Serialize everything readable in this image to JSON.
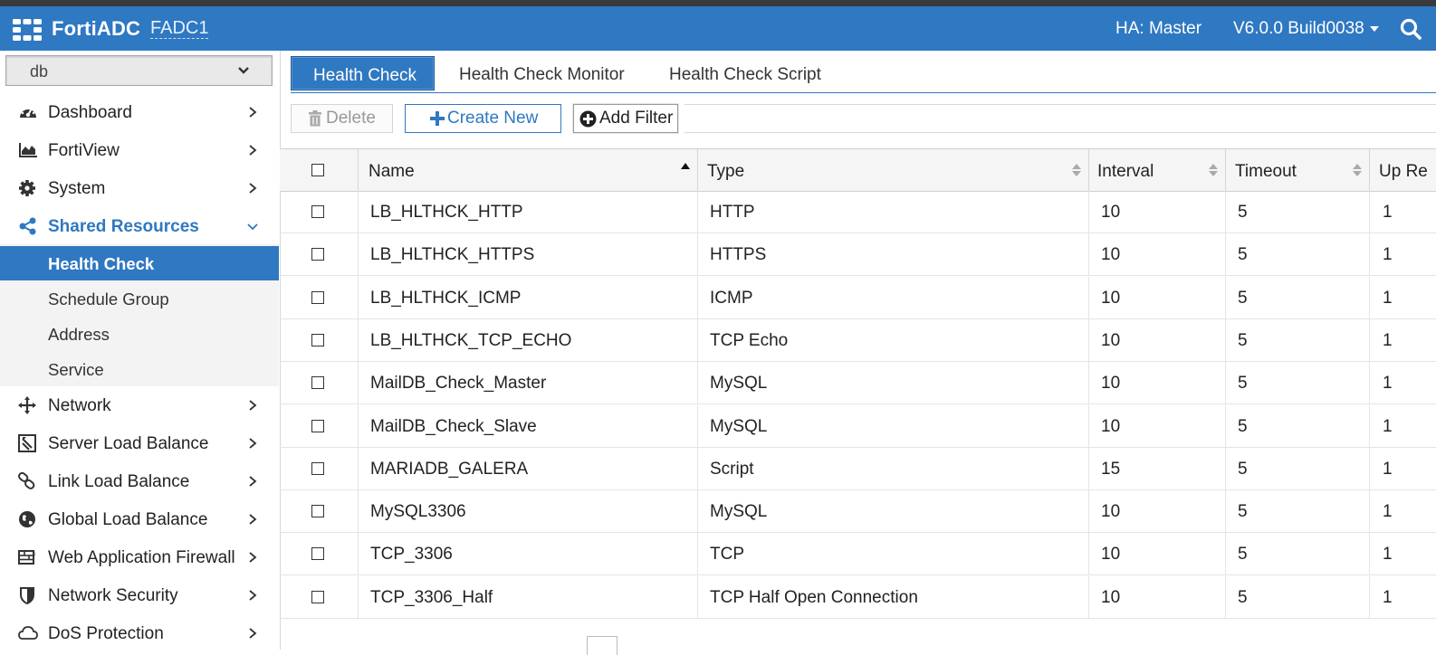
{
  "header": {
    "brand": "FortiADC",
    "device": "FADC1",
    "ha_status": "HA: Master",
    "version": "V6.0.0 Build0038"
  },
  "sidebar": {
    "vdom_selected": "db",
    "items": [
      {
        "label": "Dashboard",
        "icon": "dashboard-icon"
      },
      {
        "label": "FortiView",
        "icon": "chart-icon"
      },
      {
        "label": "System",
        "icon": "gear-icon"
      },
      {
        "label": "Shared Resources",
        "icon": "share-icon",
        "open": true
      },
      {
        "label": "Network",
        "icon": "network-icon"
      },
      {
        "label": "Server Load Balance",
        "icon": "server-load-balance-icon"
      },
      {
        "label": "Link Load Balance",
        "icon": "link-icon"
      },
      {
        "label": "Global Load Balance",
        "icon": "globe-icon"
      },
      {
        "label": "Web Application Firewall",
        "icon": "firewall-icon"
      },
      {
        "label": "Network Security",
        "icon": "shield-icon"
      },
      {
        "label": "DoS Protection",
        "icon": "cloud-icon"
      }
    ],
    "subitems": [
      {
        "label": "Health Check",
        "active": true
      },
      {
        "label": "Schedule Group"
      },
      {
        "label": "Address"
      },
      {
        "label": "Service"
      }
    ]
  },
  "tabs": [
    {
      "label": "Health Check",
      "active": true
    },
    {
      "label": "Health Check Monitor"
    },
    {
      "label": "Health Check Script"
    }
  ],
  "toolbar": {
    "delete_label": "Delete",
    "create_label": "Create New",
    "filter_label": "Add Filter"
  },
  "table": {
    "columns": [
      "Name",
      "Type",
      "Interval",
      "Timeout",
      "Up Re"
    ],
    "rows": [
      {
        "name": "LB_HLTHCK_HTTP",
        "type": "HTTP",
        "interval": "10",
        "timeout": "5",
        "up": "1"
      },
      {
        "name": "LB_HLTHCK_HTTPS",
        "type": "HTTPS",
        "interval": "10",
        "timeout": "5",
        "up": "1"
      },
      {
        "name": "LB_HLTHCK_ICMP",
        "type": "ICMP",
        "interval": "10",
        "timeout": "5",
        "up": "1"
      },
      {
        "name": "LB_HLTHCK_TCP_ECHO",
        "type": "TCP Echo",
        "interval": "10",
        "timeout": "5",
        "up": "1"
      },
      {
        "name": "MailDB_Check_Master",
        "type": "MySQL",
        "interval": "10",
        "timeout": "5",
        "up": "1"
      },
      {
        "name": "MailDB_Check_Slave",
        "type": "MySQL",
        "interval": "10",
        "timeout": "5",
        "up": "1"
      },
      {
        "name": "MARIADB_GALERA",
        "type": "Script",
        "interval": "15",
        "timeout": "5",
        "up": "1"
      },
      {
        "name": "MySQL3306",
        "type": "MySQL",
        "interval": "10",
        "timeout": "5",
        "up": "1"
      },
      {
        "name": "TCP_3306",
        "type": "TCP",
        "interval": "10",
        "timeout": "5",
        "up": "1"
      },
      {
        "name": "TCP_3306_Half",
        "type": "TCP Half Open Connection",
        "interval": "10",
        "timeout": "5",
        "up": "1"
      }
    ]
  },
  "colors": {
    "accent": "#2f78c2",
    "header_bg": "#2f78c2",
    "sub_nav_bg": "#f3f3f3"
  }
}
